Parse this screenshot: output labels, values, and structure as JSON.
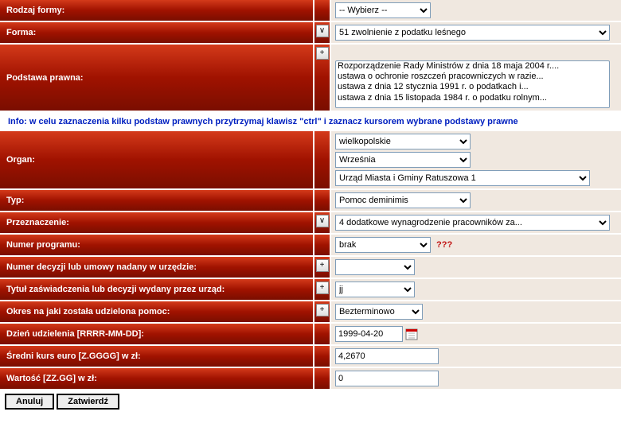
{
  "rodzaj_formy": {
    "label": "Rodzaj formy:",
    "selected": "-- Wybierz --"
  },
  "forma": {
    "label": "Forma:",
    "selected": "51    zwolnienie z podatku leśnego"
  },
  "podstawa": {
    "label": "Podstawa prawna:",
    "options": [
      "Rozporządzenie Rady Ministrów z dnia 18 maja 2004 r....",
      "ustawa o ochronie roszczeń pracowniczych w razie...",
      "ustawa z dnia 12 stycznia 1991 r. o podatkach i...",
      "ustawa z dnia 15 listopada 1984 r. o podatku rolnym..."
    ]
  },
  "info": "Info: w celu zaznaczenia kilku podstaw prawnych przytrzymaj klawisz \"ctrl\" i zaznacz kursorem wybrane podstawy prawne",
  "organ": {
    "label": "Organ:",
    "woj": "wielkopolskie",
    "miasto": "Września",
    "urzad": "Urząd Miasta i Gminy    Ratuszowa 1"
  },
  "typ": {
    "label": "Typ:",
    "selected": "Pomoc deminimis"
  },
  "przeznaczenie": {
    "label": "Przeznaczenie:",
    "selected": "4    dodatkowe wynagrodzenie pracowników za..."
  },
  "numer_programu": {
    "label": "Numer programu:",
    "selected": "brak",
    "hint": "???"
  },
  "numer_decyzji": {
    "label": "Numer decyzji lub umowy nadany w urzędzie:",
    "selected": ""
  },
  "tytul": {
    "label": "Tytuł zaświadczenia lub decyzji wydany przez urząd:",
    "selected": "jj"
  },
  "okres": {
    "label": "Okres na jaki została udzielona pomoc:",
    "selected": "Bezterminowo"
  },
  "dzien": {
    "label": "Dzień udzielenia [RRRR-MM-DD]:",
    "value": "1999-04-20"
  },
  "kurs": {
    "label": "Średni kurs euro [Z.GGGG] w zł:",
    "value": "4,2670"
  },
  "wartosc": {
    "label": "Wartość [ZZ.GG] w zł:",
    "value": "0"
  },
  "buttons": {
    "anuluj": "Anuluj",
    "zatwierdz": "Zatwierdź"
  },
  "symbols": {
    "plus": "+",
    "expand": "∨"
  }
}
